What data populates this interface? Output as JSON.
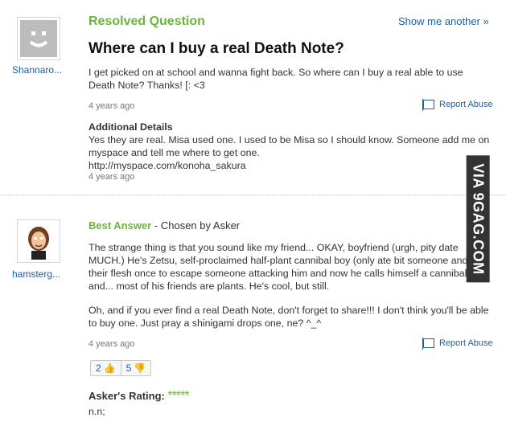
{
  "question": {
    "section_label": "Resolved Question",
    "show_another": "Show me another »",
    "title": "Where can I buy a real Death Note?",
    "body": "I get picked on at school and wanna fight back. So where can I buy a real able to use Death Note? Thanks! [: <3",
    "time": "4 years ago",
    "report_abuse": "Report Abuse",
    "additional_title": "Additional Details",
    "additional_body": "Yes they are real. Misa used one. I used to be Misa so I should know. Someone add me on myspace and tell me where to get one.",
    "additional_link": "http://myspace.com/konoha_sakura",
    "additional_time": "4 years ago",
    "asker": "Shannaro..."
  },
  "answer": {
    "best_label": "Best Answer",
    "chosen_by": "- Chosen by Asker",
    "answerer": "hamsterg...",
    "para1": "The strange thing is that you sound like my friend... OKAY, boyfriend (urgh, pity date MUCH.) He's Zetsu, self-proclaimed half-plant cannibal boy (only ate bit someone and ate their flesh once to escape someone attacking him and now he calls himself a cannibal) and... most of his friends are plants. He's cool, but still.",
    "para2": "Oh, and if you ever find a real Death Note, don't forget to share!!! I don't think you'll be able to buy one. Just pray a shinigami drops one, ne? ^_^",
    "time": "4 years ago",
    "report_abuse": "Report Abuse",
    "thumbs_up": "2",
    "thumbs_down": "5",
    "rating_label": "Asker's Rating:",
    "rating_stars": "*****",
    "rating_comment": "n.n;"
  },
  "watermark": "VIA 9GAG.COM",
  "colors": {
    "accent_green": "#6db33f",
    "link_blue": "#1c5fa8"
  }
}
